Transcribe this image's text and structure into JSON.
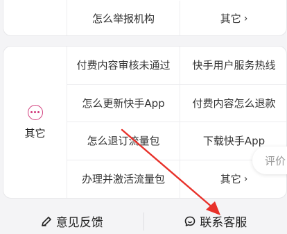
{
  "top_card": {
    "items": [
      "怎么举报机构",
      "其它"
    ]
  },
  "other_card": {
    "category_label": "其它",
    "questions": [
      "付费内容审核未通过",
      "快手用户服务热线",
      "怎么更新快手App",
      "付费内容怎么退款",
      "怎么退订流量包",
      "下载快手App",
      "办理并激活流量包",
      "其它"
    ]
  },
  "eval_tab": {
    "label": "评价"
  },
  "bottom_bar": {
    "feedback_label": "意见反馈",
    "contact_label": "联系客服"
  },
  "colors": {
    "accent": "#d13a7a",
    "annotation_arrow": "#e8312a"
  }
}
